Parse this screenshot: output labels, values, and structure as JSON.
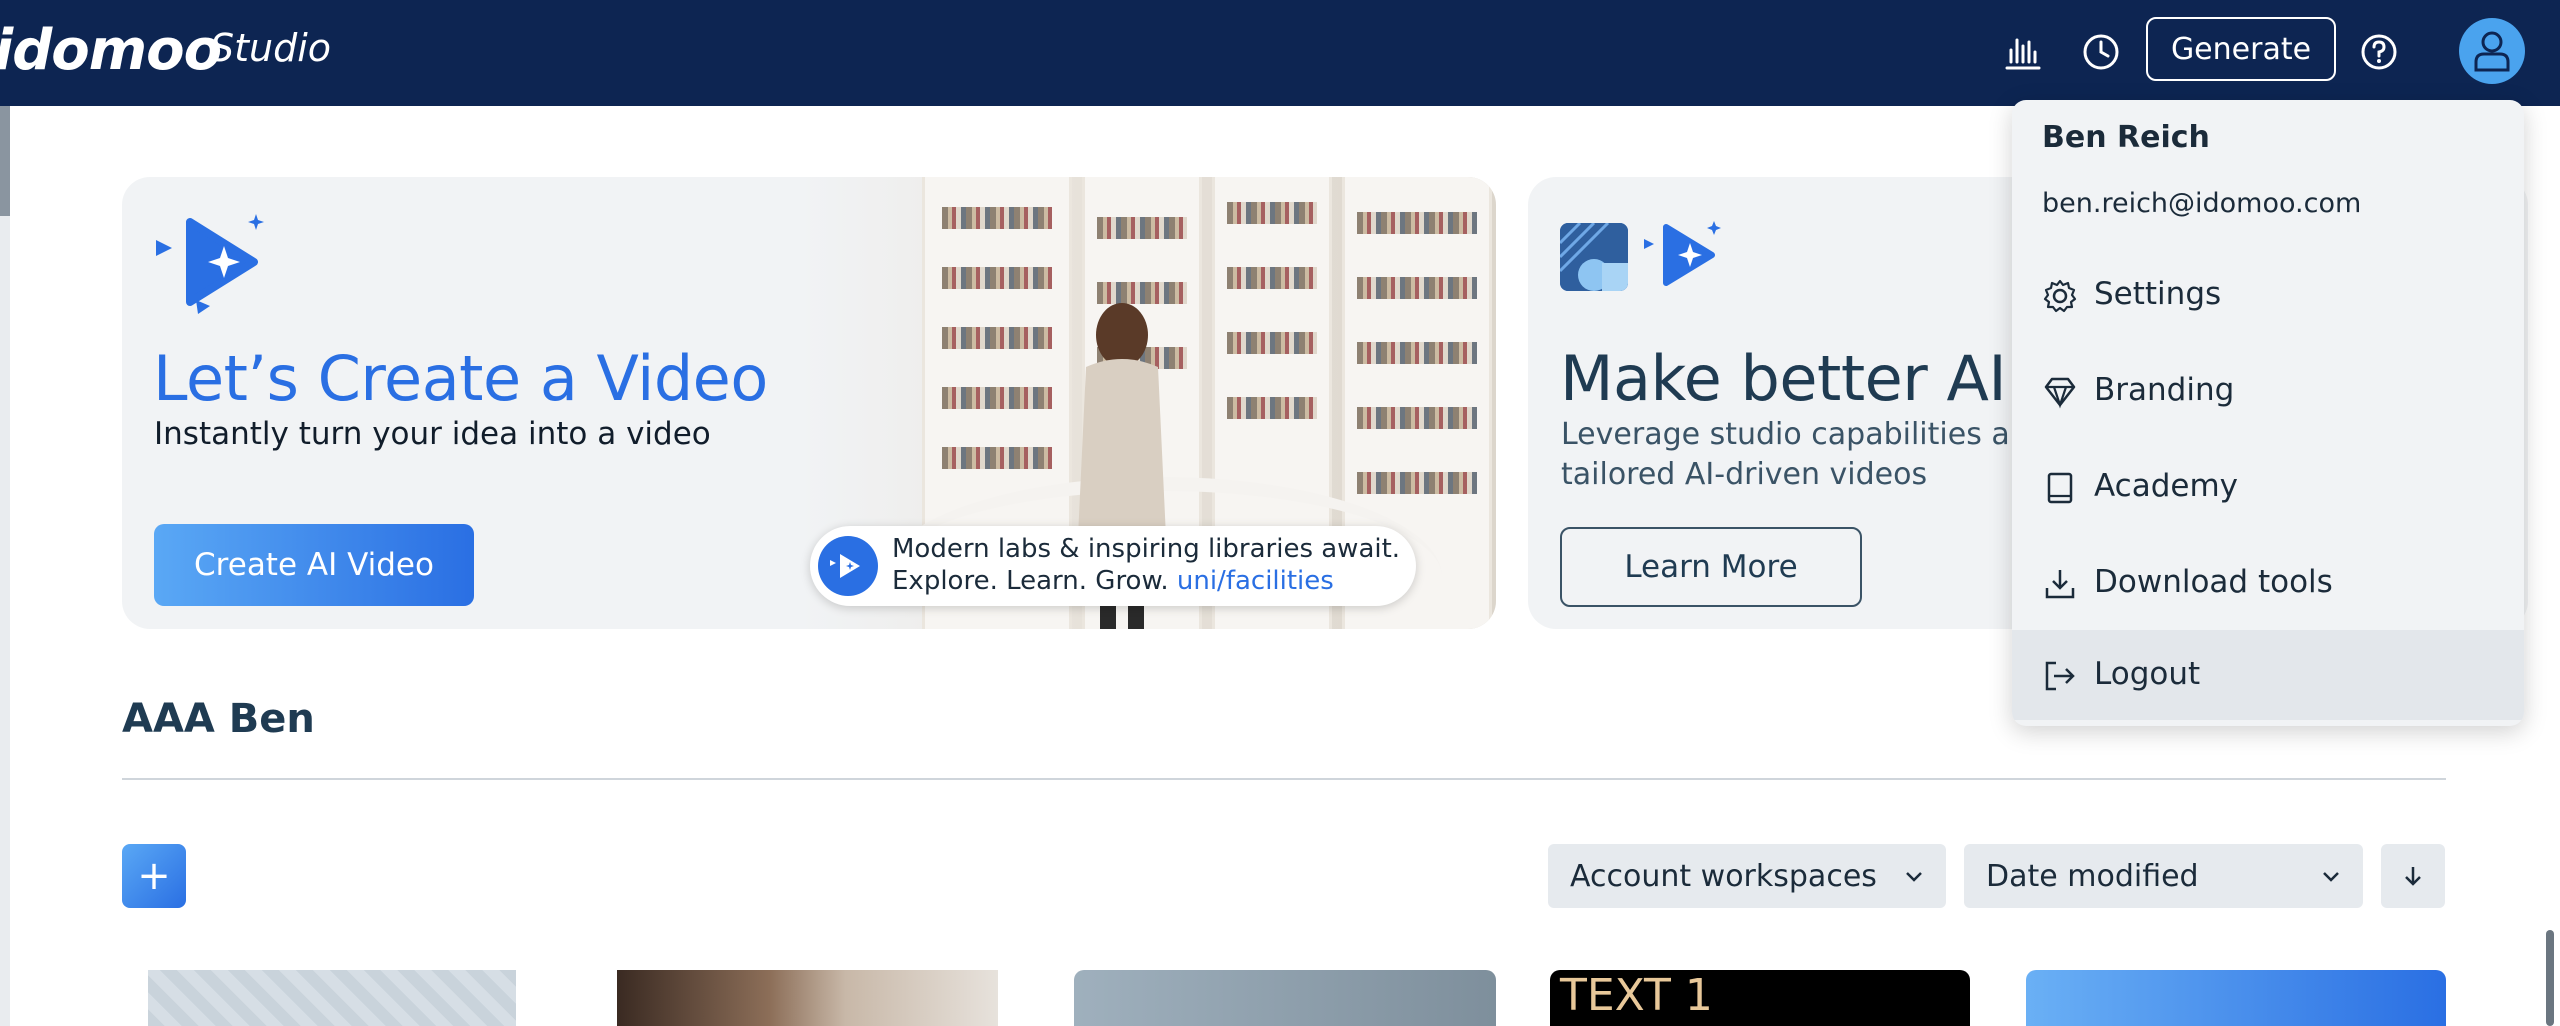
{
  "header": {
    "logo_text": "idomoo",
    "product": "Studio",
    "generate_label": "Generate",
    "icons": [
      "analytics-icon",
      "history-icon",
      "help-icon",
      "user-avatar-icon"
    ]
  },
  "hero_create": {
    "title": "Let’s Create a Video",
    "subtitle": "Instantly turn your idea into a video",
    "button_label": "Create AI Video",
    "pill_line1": "Modern labs & inspiring libraries await.",
    "pill_line2_prefix": "Explore. Learn. Grow. ",
    "pill_link": "uni/facilities"
  },
  "hero_learn": {
    "title": "Make better AI v",
    "subtitle_line1": "Leverage studio capabilities an",
    "subtitle_line2": "tailored AI-driven videos",
    "button_label": "Learn More"
  },
  "section": {
    "title": "AAA Ben",
    "add_label": "+",
    "workspace_filter": "Account workspaces",
    "sort_by": "Date modified"
  },
  "thumbnails": [
    {
      "caption": ""
    },
    {
      "caption": ""
    },
    {
      "caption": ""
    },
    {
      "caption": "TEXT 1"
    },
    {
      "caption": ""
    }
  ],
  "user_menu": {
    "name": "Ben Reich",
    "email": "ben.reich@idomoo.com",
    "items": [
      {
        "label": "Settings",
        "icon": "gear-icon"
      },
      {
        "label": "Branding",
        "icon": "diamond-icon"
      },
      {
        "label": "Academy",
        "icon": "book-icon"
      },
      {
        "label": "Download tools",
        "icon": "download-icon"
      },
      {
        "label": "Logout",
        "icon": "logout-icon"
      }
    ]
  },
  "colors": {
    "header_bg": "#0d2552",
    "accent_blue": "#2a6fe3",
    "card_bg": "#f1f3f5"
  }
}
